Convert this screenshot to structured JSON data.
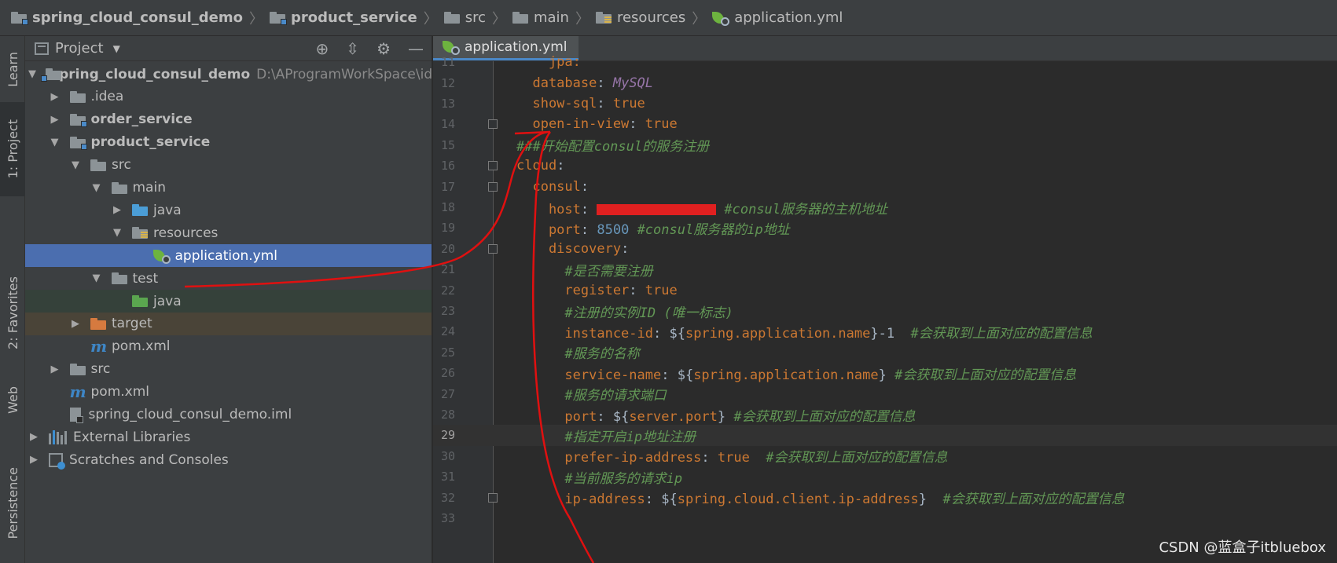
{
  "breadcrumb": [
    {
      "label": "spring_cloud_consul_demo",
      "icon": "module-folder-icon",
      "bold": true
    },
    {
      "label": "product_service",
      "icon": "module-folder-icon",
      "bold": true
    },
    {
      "label": "src",
      "icon": "folder-icon",
      "bold": false
    },
    {
      "label": "main",
      "icon": "folder-icon",
      "bold": false
    },
    {
      "label": "resources",
      "icon": "resources-folder-icon",
      "bold": false
    },
    {
      "label": "application.yml",
      "icon": "spring-yml-icon",
      "bold": false
    }
  ],
  "tool_strip": {
    "learn": "Learn",
    "project": "1: Project",
    "favorites": "2: Favorites",
    "web": "Web",
    "persistence": "Persistence"
  },
  "project_panel": {
    "title": "Project",
    "tree": [
      {
        "label": "spring_cloud_consul_demo",
        "path": "D:\\AProgramWorkSpace\\idea\\test",
        "indent": 0,
        "arrow": "expanded",
        "icon": "module",
        "bold": true
      },
      {
        "label": ".idea",
        "indent": 1,
        "arrow": "collapsed",
        "icon": "folder"
      },
      {
        "label": "order_service",
        "indent": 1,
        "arrow": "collapsed",
        "icon": "module",
        "bold": true
      },
      {
        "label": "product_service",
        "indent": 1,
        "arrow": "expanded",
        "icon": "module",
        "bold": true
      },
      {
        "label": "src",
        "indent": 2,
        "arrow": "expanded",
        "icon": "folder"
      },
      {
        "label": "main",
        "indent": 3,
        "arrow": "expanded",
        "icon": "folder"
      },
      {
        "label": "java",
        "indent": 4,
        "arrow": "collapsed",
        "icon": "blue"
      },
      {
        "label": "resources",
        "indent": 4,
        "arrow": "expanded",
        "icon": "res"
      },
      {
        "label": "application.yml",
        "indent": 5,
        "arrow": "none",
        "icon": "spring",
        "selected": true
      },
      {
        "label": "test",
        "indent": 3,
        "arrow": "expanded",
        "icon": "folder"
      },
      {
        "label": "java",
        "indent": 4,
        "arrow": "none",
        "icon": "green",
        "bg": "green"
      },
      {
        "label": "target",
        "indent": 2,
        "arrow": "collapsed",
        "icon": "orange",
        "bg": "brown"
      },
      {
        "label": "pom.xml",
        "indent": 2,
        "arrow": "none",
        "icon": "maven"
      },
      {
        "label": "src",
        "indent": 1,
        "arrow": "collapsed",
        "icon": "folder"
      },
      {
        "label": "pom.xml",
        "indent": 1,
        "arrow": "none",
        "icon": "maven"
      },
      {
        "label": "spring_cloud_consul_demo.iml",
        "indent": 1,
        "arrow": "none",
        "icon": "iml"
      },
      {
        "label": "External Libraries",
        "indent": 0,
        "arrow": "collapsed",
        "icon": "lib"
      },
      {
        "label": "Scratches and Consoles",
        "indent": 0,
        "arrow": "collapsed",
        "icon": "scratch"
      }
    ]
  },
  "editor": {
    "tab_label": "application.yml",
    "current_line": 29,
    "lines": [
      {
        "n": "11",
        "tokens": [
          {
            "t": "    jpa:",
            "c": "k"
          }
        ]
      },
      {
        "n": "12",
        "tokens": [
          {
            "t": "  database",
            "c": "k"
          },
          {
            "t": ": ",
            "c": "vp"
          },
          {
            "t": "MySQL",
            "c": "vi"
          }
        ]
      },
      {
        "n": "13",
        "tokens": [
          {
            "t": "  show-sql",
            "c": "k"
          },
          {
            "t": ": ",
            "c": "vp"
          },
          {
            "t": "true",
            "c": "v"
          }
        ]
      },
      {
        "n": "14",
        "tokens": [
          {
            "t": "  open-in-view",
            "c": "k"
          },
          {
            "t": ": ",
            "c": "vp"
          },
          {
            "t": "true",
            "c": "v"
          }
        ]
      },
      {
        "n": "15",
        "tokens": [
          {
            "t": "###开始配置consul的服务注册",
            "c": "cm"
          }
        ]
      },
      {
        "n": "16",
        "tokens": [
          {
            "t": "cloud",
            "c": "k"
          },
          {
            "t": ":",
            "c": "vp"
          }
        ]
      },
      {
        "n": "17",
        "tokens": [
          {
            "t": "  consul",
            "c": "k"
          },
          {
            "t": ":",
            "c": "vp"
          }
        ]
      },
      {
        "n": "18",
        "tokens": [
          {
            "t": "    host",
            "c": "k"
          },
          {
            "t": ": ",
            "c": "vp"
          },
          {
            "t": "",
            "c": "redact"
          },
          {
            "t": "#consul服务器的主机地址",
            "c": "cm"
          }
        ]
      },
      {
        "n": "19",
        "tokens": [
          {
            "t": "    port",
            "c": "k"
          },
          {
            "t": ": ",
            "c": "vp"
          },
          {
            "t": "8500 ",
            "c": "vn"
          },
          {
            "t": "#consul服务器的ip地址",
            "c": "cm"
          }
        ]
      },
      {
        "n": "20",
        "tokens": [
          {
            "t": "    discovery",
            "c": "k"
          },
          {
            "t": ":",
            "c": "vp"
          }
        ]
      },
      {
        "n": "21",
        "tokens": [
          {
            "t": "      #是否需要注册",
            "c": "cm"
          }
        ]
      },
      {
        "n": "22",
        "tokens": [
          {
            "t": "      register",
            "c": "k"
          },
          {
            "t": ": ",
            "c": "vp"
          },
          {
            "t": "true",
            "c": "v"
          }
        ]
      },
      {
        "n": "23",
        "tokens": [
          {
            "t": "      #注册的实例ID (唯一标志)",
            "c": "cm"
          }
        ]
      },
      {
        "n": "24",
        "tokens": [
          {
            "t": "      instance-id",
            "c": "k"
          },
          {
            "t": ": ${",
            "c": "vp"
          },
          {
            "t": "spring.application.name",
            "c": "v"
          },
          {
            "t": "}-1  ",
            "c": "vp"
          },
          {
            "t": "#会获取到上面对应的配置信息",
            "c": "cm"
          }
        ]
      },
      {
        "n": "25",
        "tokens": [
          {
            "t": "      #服务的名称",
            "c": "cm"
          }
        ]
      },
      {
        "n": "26",
        "tokens": [
          {
            "t": "      service-name",
            "c": "k"
          },
          {
            "t": ": ${",
            "c": "vp"
          },
          {
            "t": "spring.application.name",
            "c": "v"
          },
          {
            "t": "} ",
            "c": "vp"
          },
          {
            "t": "#会获取到上面对应的配置信息",
            "c": "cm"
          }
        ]
      },
      {
        "n": "27",
        "tokens": [
          {
            "t": "      #服务的请求端口",
            "c": "cm"
          }
        ]
      },
      {
        "n": "28",
        "tokens": [
          {
            "t": "      port",
            "c": "k"
          },
          {
            "t": ": ${",
            "c": "vp"
          },
          {
            "t": "server.port",
            "c": "v"
          },
          {
            "t": "} ",
            "c": "vp"
          },
          {
            "t": "#会获取到上面对应的配置信息",
            "c": "cm"
          }
        ]
      },
      {
        "n": "29",
        "tokens": [
          {
            "t": "      #指定开启ip地址注册",
            "c": "cm"
          }
        ]
      },
      {
        "n": "30",
        "tokens": [
          {
            "t": "      prefer-ip-address",
            "c": "k"
          },
          {
            "t": ": ",
            "c": "vp"
          },
          {
            "t": "true  ",
            "c": "v"
          },
          {
            "t": "#会获取到上面对应的配置信息",
            "c": "cm"
          }
        ]
      },
      {
        "n": "31",
        "tokens": [
          {
            "t": "      #当前服务的请求ip",
            "c": "cm"
          }
        ]
      },
      {
        "n": "32",
        "tokens": [
          {
            "t": "      ip-address",
            "c": "k"
          },
          {
            "t": ": ${",
            "c": "vp"
          },
          {
            "t": "spring.cloud.client.ip-address",
            "c": "v"
          },
          {
            "t": "}  ",
            "c": "vp"
          },
          {
            "t": "#会获取到上面对应的配置信息",
            "c": "cm"
          }
        ]
      },
      {
        "n": "33",
        "tokens": []
      }
    ],
    "fold_lines": [
      "14",
      "16",
      "17",
      "20",
      "32"
    ]
  },
  "watermark": "CSDN @蓝盒子itbluebox",
  "colors": {
    "selection": "#4b6eaf",
    "annotation": "#e01010",
    "key": "#cc7832",
    "comment": "#629755",
    "number": "#6897bb"
  }
}
